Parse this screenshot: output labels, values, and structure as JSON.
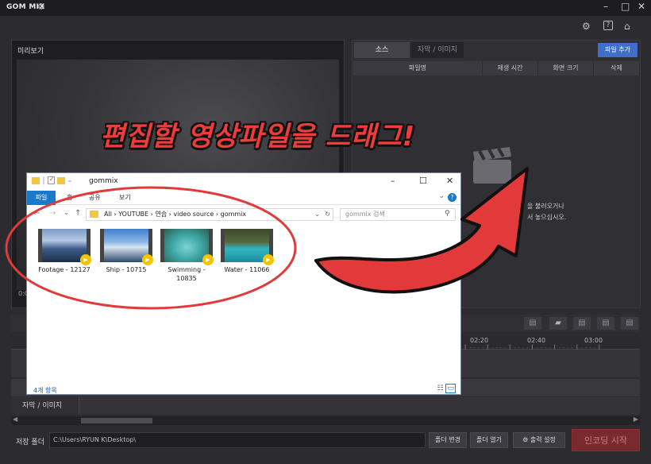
{
  "app": {
    "title": "GOM MIX"
  },
  "preview": {
    "label": "미리보기",
    "time": "0:0"
  },
  "source_panel": {
    "tab_source": "소스",
    "tab_subtitle": "자막 / 이미지",
    "add_file": "파일 추가",
    "columns": {
      "filename": "파일명",
      "duration": "재생 시간",
      "resolution": "화면 크기",
      "delete": "삭제"
    },
    "drop_line1": "을 불러오거나",
    "drop_line2": "서 놓으십시오."
  },
  "headline": "편집할 영상파일을 드래그!",
  "timeline": {
    "ruler": [
      "02:20",
      "02:40",
      "03:00"
    ],
    "subtitle_track": "자막 / 이미지"
  },
  "bottom": {
    "save_label": "저장 폴더",
    "save_path": "C:\\Users\\RYUN K\\Desktop\\",
    "change_folder": "폴더 변경",
    "open_folder": "폴더 열기",
    "output_settings": "출력 설정",
    "start_encoding": "인코딩 시작"
  },
  "explorer": {
    "title": "gommix",
    "tabs": {
      "file": "파일",
      "home": "홈",
      "share": "공유",
      "view": "보기"
    },
    "breadcrumb": "All  ›  YOUTUBE  ›  연습  ›  video source  ›  gommix",
    "search_placeholder": "gommix 검색",
    "files": [
      {
        "name": "Footage - 12127"
      },
      {
        "name": "Ship - 10715"
      },
      {
        "name": "Swimming - 10835"
      },
      {
        "name": "Water - 11066"
      }
    ],
    "status": "4개 항목"
  },
  "colors": {
    "headline": "#ef3b3b",
    "accent": "#3f6fc9",
    "encode": "#7a2a2f",
    "explorer_file_tab": "#1979ca"
  }
}
